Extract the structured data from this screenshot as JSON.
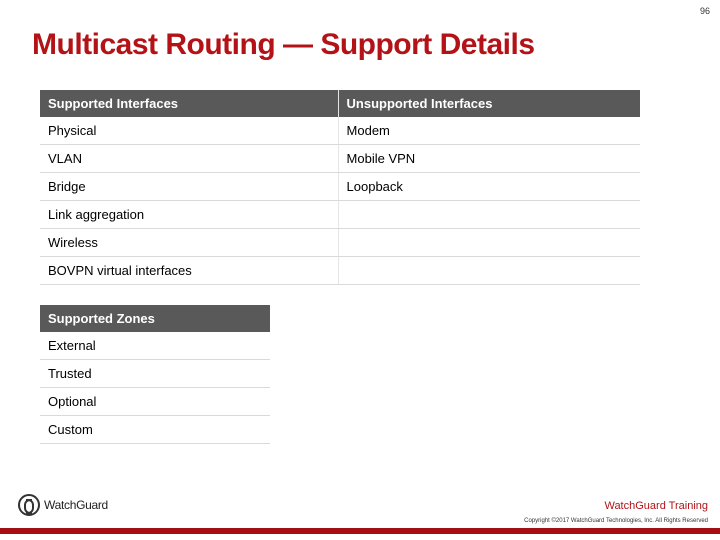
{
  "page_number": "96",
  "title": "Multicast Routing — Support Details",
  "interfaces": {
    "headers": [
      "Supported Interfaces",
      "Unsupported Interfaces"
    ],
    "rows": [
      [
        "Physical",
        "Modem"
      ],
      [
        "VLAN",
        "Mobile VPN"
      ],
      [
        "Bridge",
        "Loopback"
      ],
      [
        "Link aggregation",
        ""
      ],
      [
        "Wireless",
        ""
      ],
      [
        "BOVPN virtual interfaces",
        ""
      ]
    ]
  },
  "zones": {
    "header": "Supported Zones",
    "rows": [
      "External",
      "Trusted",
      "Optional",
      "Custom"
    ]
  },
  "logo_text": "WatchGuard",
  "training_label": "WatchGuard Training",
  "copyright": "Copyright ©2017 WatchGuard Technologies, Inc. All Rights Reserved"
}
